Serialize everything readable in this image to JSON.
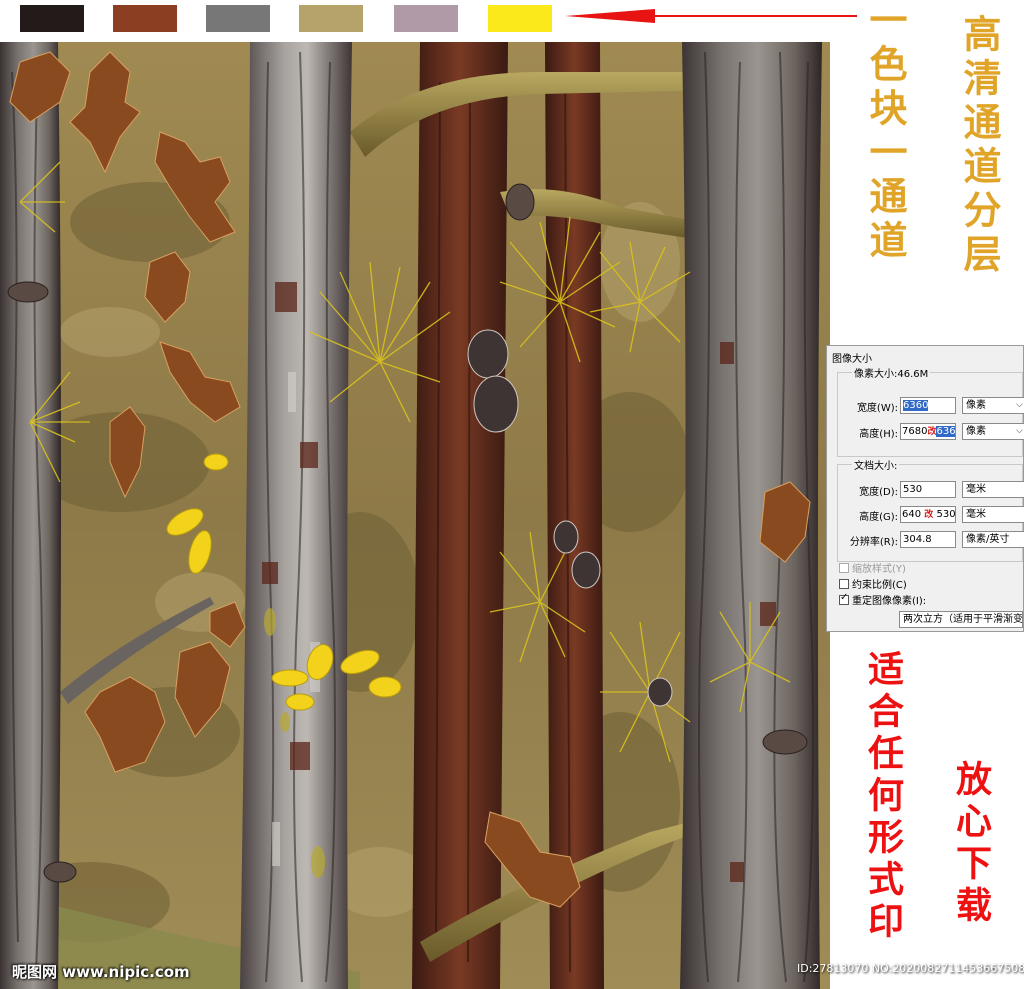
{
  "swatches": [
    {
      "name": "dark-brown",
      "color": "#231a1a"
    },
    {
      "name": "rust-brown",
      "color": "#8c3e22"
    },
    {
      "name": "gray",
      "color": "#777777"
    },
    {
      "name": "khaki",
      "color": "#b5a36a"
    },
    {
      "name": "mauve",
      "color": "#b09aa8"
    },
    {
      "name": "yellow",
      "color": "#fbe91c"
    }
  ],
  "arrow": {
    "icon": "left-arrow-icon",
    "color": "#e81414"
  },
  "side_text": {
    "col_one": "一色块一通道",
    "col_two": "高清通道分层",
    "col_three": "适合任何形式印",
    "col_four": "放心下载"
  },
  "dialog": {
    "title": "图像大小",
    "pixel_size": "像素大小:46.6M",
    "width_label": "宽度(W):",
    "width_value": "6360",
    "width_unit": "像素",
    "height_label": "高度(H):",
    "height_value_old": "7680",
    "height_mark": "改",
    "height_value_new": "6360",
    "height_unit": "像素",
    "doc_size_title": "文档大小:",
    "doc_width_label": "宽度(D):",
    "doc_width_value": "530",
    "doc_width_unit": "毫米",
    "doc_height_label": "高度(G):",
    "doc_height_value_old": "640",
    "doc_height_mark": "改",
    "doc_height_value_new": "530",
    "doc_height_unit": "毫米",
    "resolution_label": "分辨率(R):",
    "resolution_value": "304.8",
    "resolution_unit": "像素/英寸",
    "scale_styles_label": "缩放样式(Y)",
    "constrain_label": "约束比例(C)",
    "resample_label": "重定图像像素(I):",
    "resample_method": "两次立方（适用于平滑渐变"
  },
  "watermark": {
    "site_name": "昵图网",
    "site_url": "www.nipic.com",
    "id_text": "ID:27813070 NO:20200827114536675084"
  }
}
